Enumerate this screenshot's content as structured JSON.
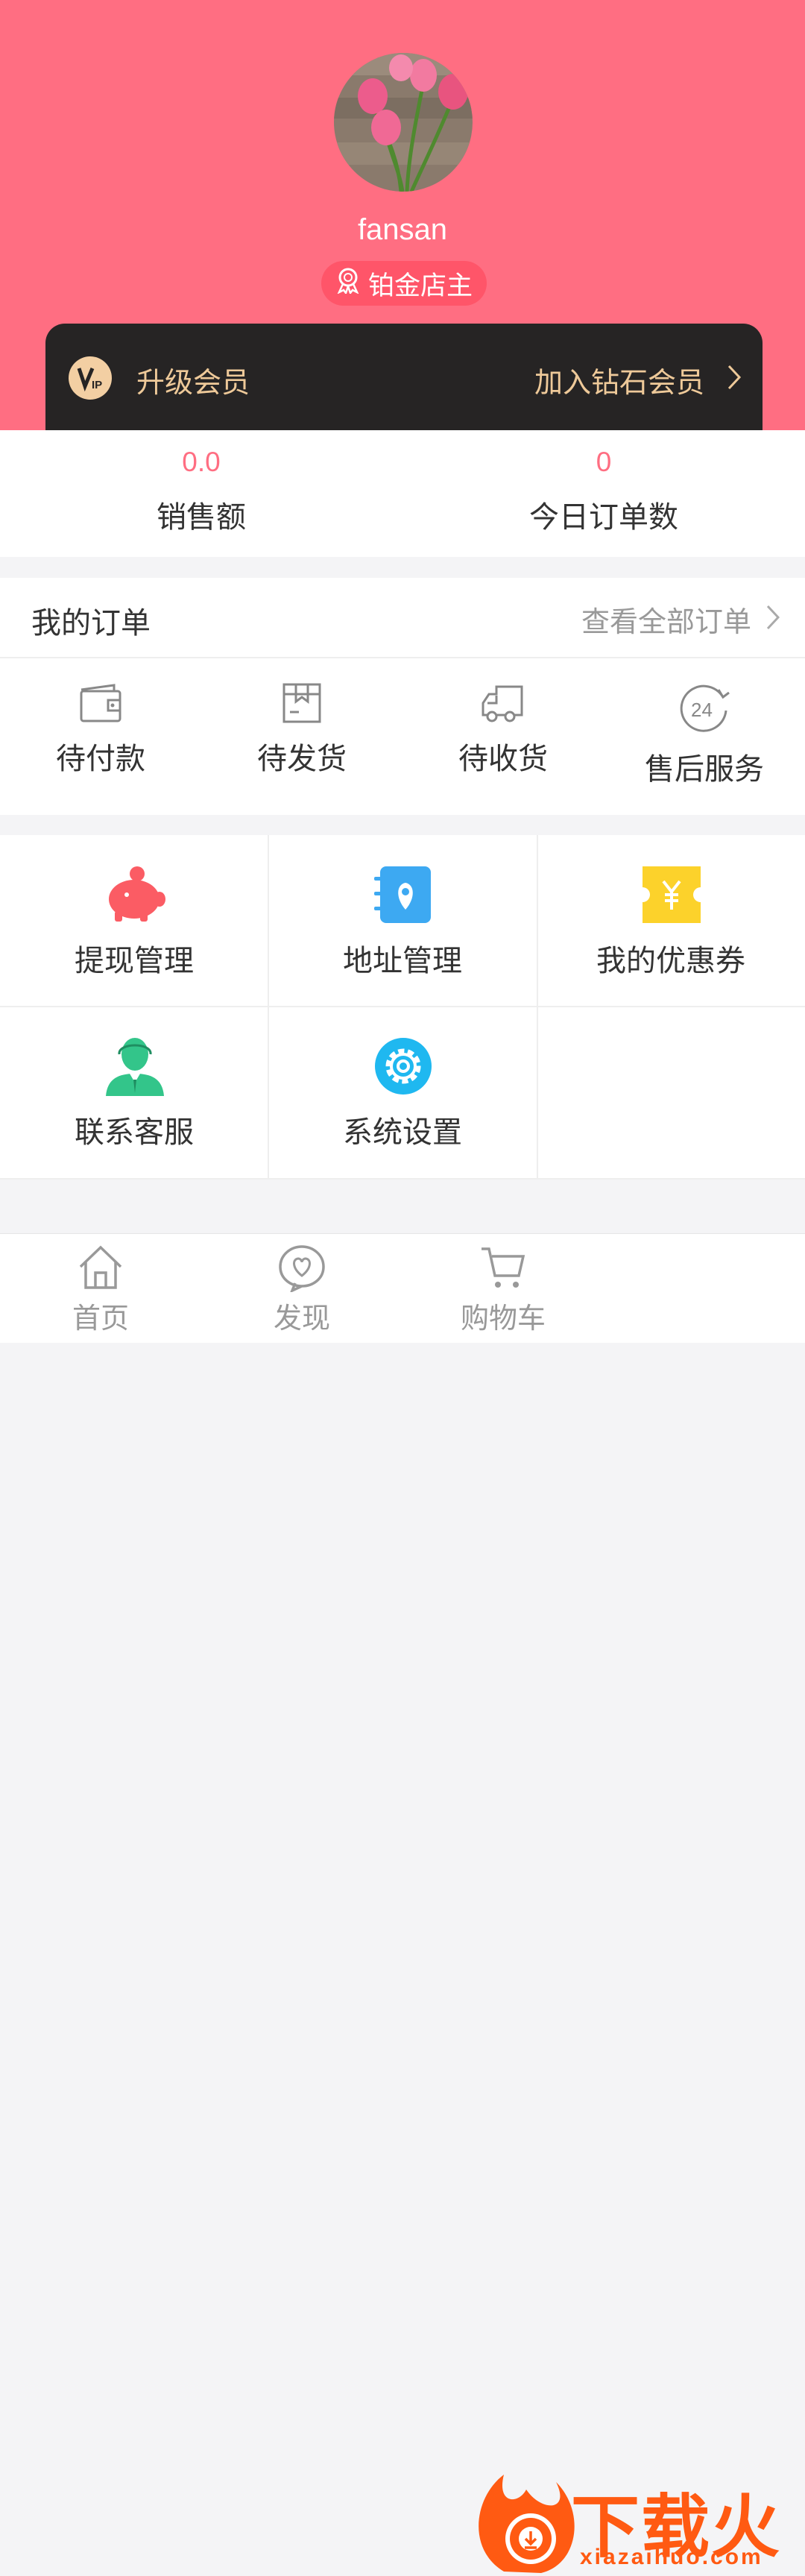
{
  "profile": {
    "username": "fansan",
    "level": "铂金店主"
  },
  "vip": {
    "logo_text": "VIP",
    "title": "升级会员",
    "cta": "加入钻石会员"
  },
  "stats": [
    {
      "value": "0.0",
      "label": "销售额"
    },
    {
      "value": "0",
      "label": "今日订单数"
    }
  ],
  "orders": {
    "title": "我的订单",
    "view_all": "查看全部订单",
    "items": [
      {
        "label": "待付款",
        "icon": "wallet-icon"
      },
      {
        "label": "待发货",
        "icon": "package-icon"
      },
      {
        "label": "待收货",
        "icon": "truck-icon"
      },
      {
        "label": "售后服务",
        "icon": "24h-service-icon"
      }
    ]
  },
  "services": [
    {
      "label": "提现管理",
      "icon": "piggy-bank-icon"
    },
    {
      "label": "地址管理",
      "icon": "address-book-icon"
    },
    {
      "label": "我的优惠券",
      "icon": "coupon-icon"
    },
    {
      "label": "联系客服",
      "icon": "customer-service-icon"
    },
    {
      "label": "系统设置",
      "icon": "settings-gear-icon"
    }
  ],
  "tabbar": [
    {
      "label": "首页",
      "icon": "home-icon"
    },
    {
      "label": "发现",
      "icon": "discover-heart-icon"
    },
    {
      "label": "购物车",
      "icon": "cart-icon"
    }
  ],
  "watermark": {
    "text": "下载火",
    "url": "xiazaihuo.com"
  },
  "colors": {
    "header": "#ff6e82",
    "badge": "#ff5569",
    "vip_bar": "#262424",
    "vip_gold": "#eec999",
    "accent": "#ff6e82"
  }
}
